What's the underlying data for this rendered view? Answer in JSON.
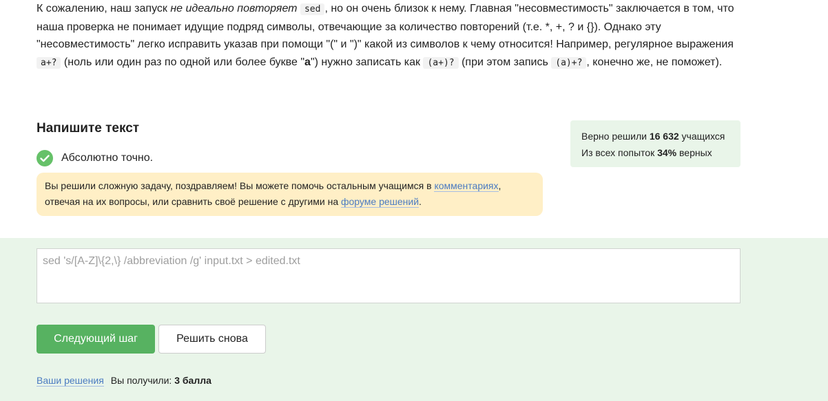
{
  "intro": {
    "t1": "К сожалению, наш запуск ",
    "t1_em": "не идеально повторяет",
    "t2": " ",
    "code_sed": "sed",
    "t3": ", но он очень близок к нему. Главная \"несовместимость\" заключается в том, что наша проверка не понимает идущие подряд символы, отвечающие за количество повторений (т.е. *, +, ? и {}). Однако эту \"несовместимость\" легко исправить указав при помощи \"(\" и \")\" какой из символов к чему относится! Например, регулярное выражения ",
    "code_a_plus": "a+?",
    "t4": " (ноль или один раз по одной или более букве \"",
    "t4_bold": "a",
    "t5": "\") нужно записать как ",
    "code_group": "(a+)?",
    "t6": " (при этом запись ",
    "code_group2": "(a)+?",
    "t7": ", конечно же, не поможет)."
  },
  "task": {
    "title": "Напишите текст",
    "status": "Абсолютно точно."
  },
  "notice": {
    "t1": "Вы решили сложную задачу, поздравляем! Вы можете помочь остальным учащимся в ",
    "link1": "комментариях",
    "t2": ", отвечая на их вопросы, или сравнить своё решение с другими на ",
    "link2": "форуме решений",
    "t3": "."
  },
  "stats": {
    "solved_prefix": "Верно решили ",
    "solved_count": "16 632",
    "solved_suffix": " учащихся",
    "attempts_prefix": "Из всех попыток ",
    "attempts_percent": "34%",
    "attempts_suffix": " верных"
  },
  "answer": {
    "value": "sed 's/[A-Z]\\{2,\\} /abbreviation /g' input.txt > edited.txt"
  },
  "buttons": {
    "next": "Следующий шаг",
    "retry": "Решить снова"
  },
  "footer": {
    "solutions_link": "Ваши решения",
    "score_prefix": "Вы получили: ",
    "score_value": "3 балла"
  },
  "colors": {
    "success": "#66c169",
    "primary_button": "#57b261",
    "notice_bg": "#ffefc6",
    "stats_bg": "#e9f5e9",
    "link": "#4b7bc1"
  }
}
